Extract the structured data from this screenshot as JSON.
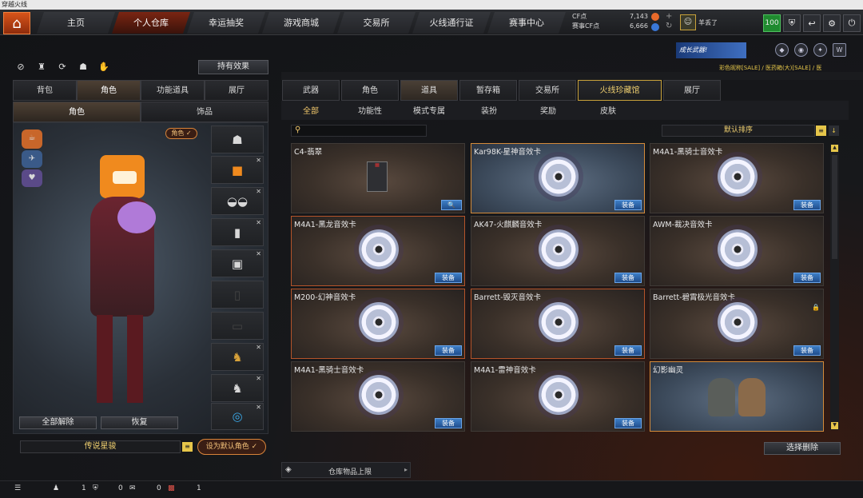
{
  "window_title": "穿越火线",
  "nav": [
    "主页",
    "个人仓库",
    "幸运抽奖",
    "游戏商城",
    "交易所",
    "火线通行证",
    "赛事中心"
  ],
  "currency": {
    "cf_label": "CF点",
    "cf_value": "7,143",
    "match_label": "赛事CF点",
    "match_value": "6,666"
  },
  "user": {
    "name": "羊丢了",
    "level": "100"
  },
  "banner_text": "成长武器!",
  "marquee": "彩色昵称[SALE] / 医药箱(大)[SALE] / 医",
  "left": {
    "hold_effect": "持有效果",
    "tabs": [
      "背包",
      "角色",
      "功能道具",
      "展厅"
    ],
    "subtabs": [
      "角色",
      "饰品"
    ],
    "role_badge": "角色 ✓",
    "btn_clear": "全部解除",
    "btn_restore": "恢复",
    "char_name": "传说星骏",
    "set_default": "设为默认角色 ✓"
  },
  "right": {
    "tabs": [
      "武器",
      "角色",
      "道具",
      "暂存箱",
      "交易所",
      "火线珍藏馆",
      "展厅"
    ],
    "filters": [
      "全部",
      "功能性",
      "模式专属",
      "装扮",
      "奖励",
      "皮肤"
    ],
    "sort_label": "默认排序",
    "delete_btn": "选择删除",
    "storage_label": "仓库物品上限"
  },
  "cards": [
    {
      "name": "C4-翡翠",
      "action": "🔍"
    },
    {
      "name": "Kar98K-星神音效卡",
      "action": "装备"
    },
    {
      "name": "M4A1-黑骑士音效卡",
      "action": "装备"
    },
    {
      "name": "M4A1-黑龙音效卡",
      "action": "装备"
    },
    {
      "name": "AK47-火麒麟音效卡",
      "action": "装备"
    },
    {
      "name": "AWM-裁决音效卡",
      "action": "装备"
    },
    {
      "name": "M200-幻神音效卡",
      "action": "装备"
    },
    {
      "name": "Barrett-毁灭音效卡",
      "action": "装备"
    },
    {
      "name": "Barrett-碧霄极光音效卡",
      "action": "装备"
    },
    {
      "name": "M4A1-黑骑士音效卡",
      "action": "装备"
    },
    {
      "name": "M4A1-雷神音效卡",
      "action": "装备"
    },
    {
      "name": "幻影幽灵",
      "action": ""
    }
  ],
  "bottom": {
    "c1": "1",
    "c2": "0",
    "c3": "0",
    "c4": "1"
  }
}
